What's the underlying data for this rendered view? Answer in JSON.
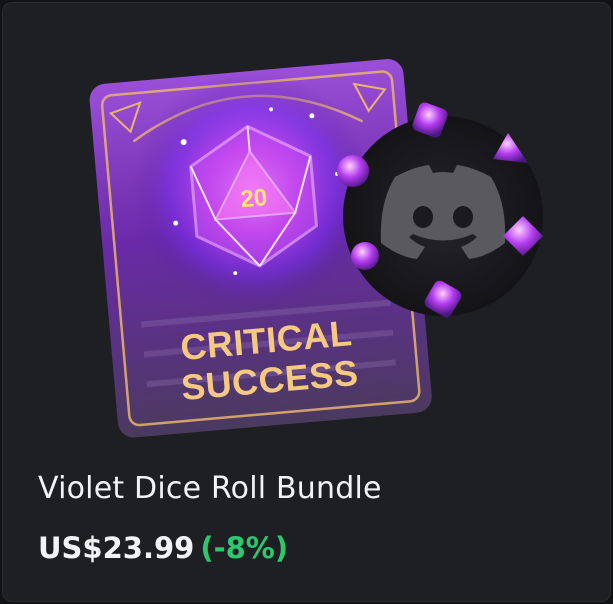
{
  "product": {
    "name": "Violet Dice Roll Bundle",
    "price": "US$23.99",
    "discount": "(-8%)"
  },
  "art": {
    "card_text_line1": "CRITICAL",
    "card_text_line2": "SUCCESS",
    "die_number": "20",
    "badge_icon": "discord-logo-icon",
    "colors": {
      "card_purple": "#7a2fb8",
      "glow_pink": "#e84cff",
      "gold": "#e9b46f",
      "badge_bg": "#1b1b1f",
      "discord_logo": "#5a5a5e"
    }
  },
  "colors": {
    "card_bg": "#1e1f22",
    "name_text": "#f2f3f5",
    "price_text": "#f2f3f5",
    "discount_text": "#2dc770"
  }
}
